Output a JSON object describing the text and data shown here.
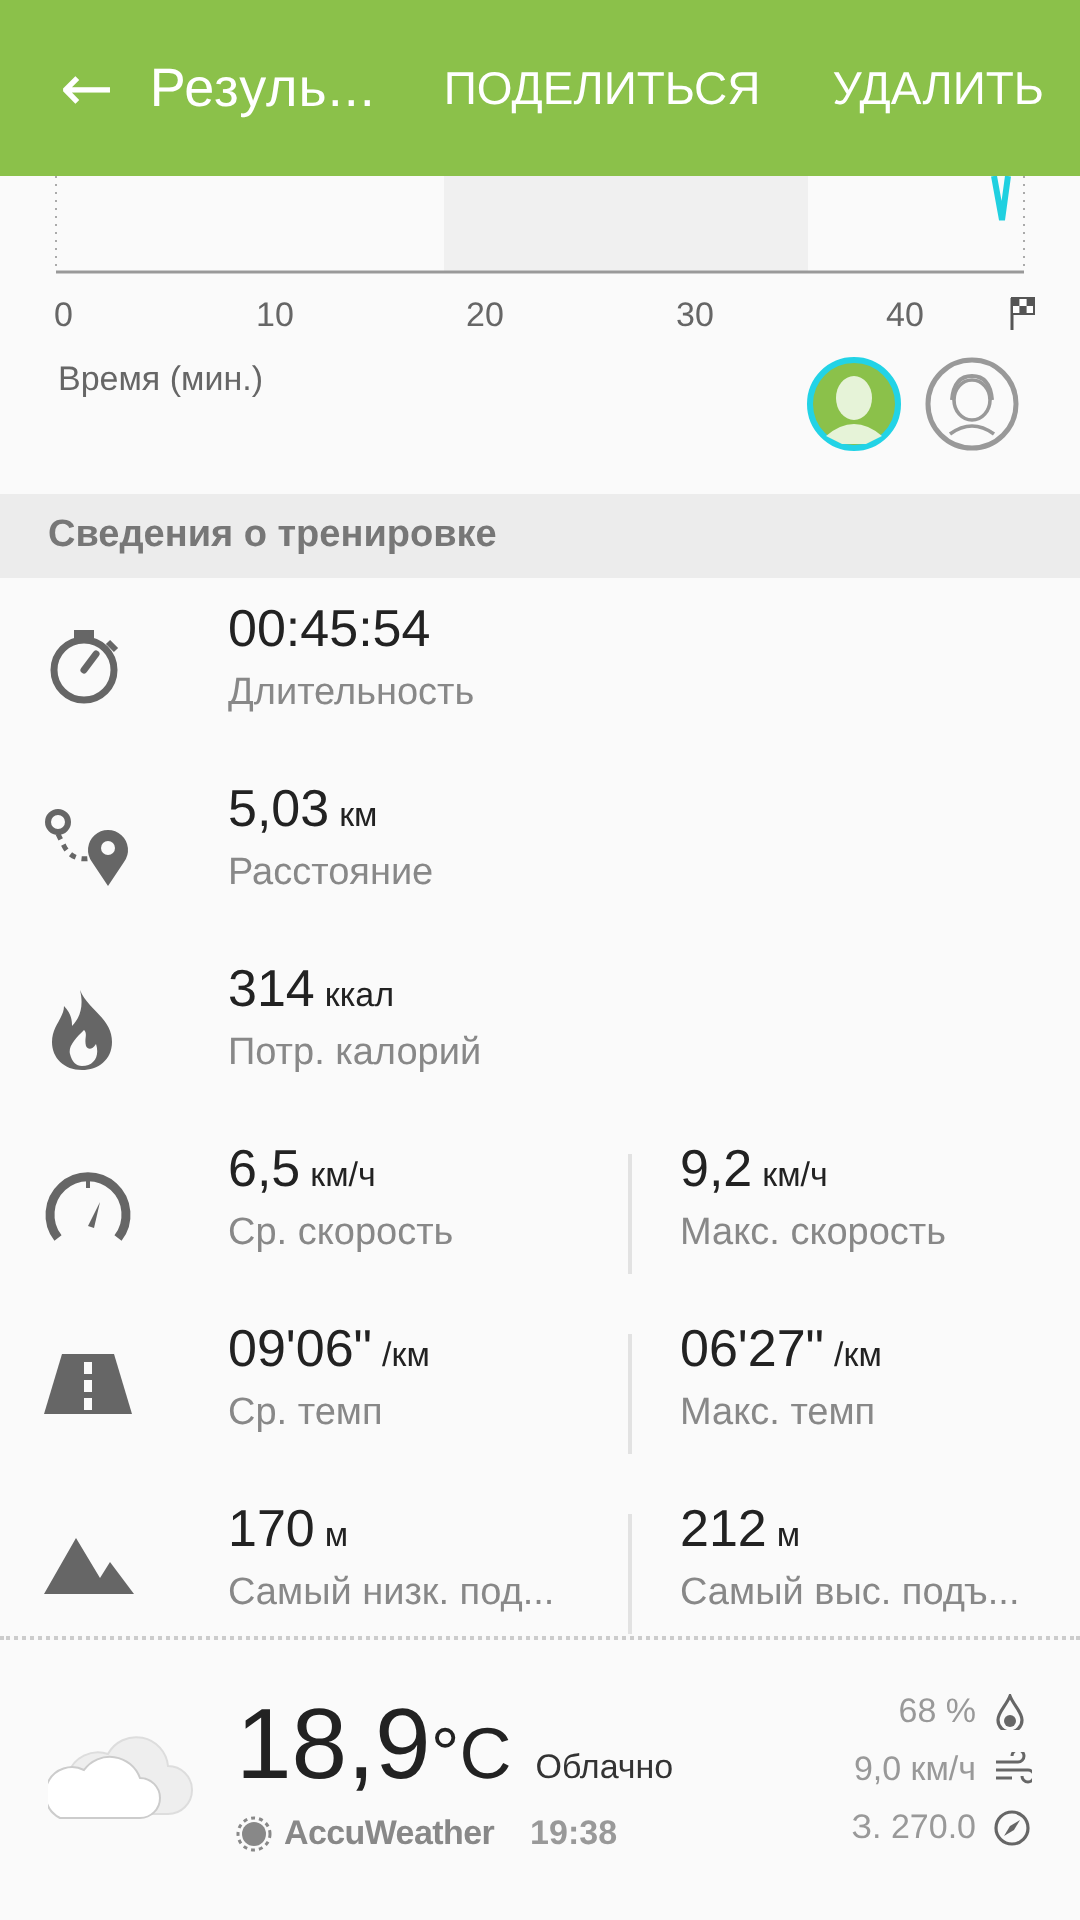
{
  "header": {
    "back": "←",
    "title": "Резуль...",
    "actions": [
      "ПОДЕЛИТЬСЯ",
      "УДАЛИТЬ"
    ]
  },
  "chart": {
    "x_ticks": [
      "0",
      "10",
      "20",
      "30",
      "40"
    ],
    "x_label": "Время (мин.)"
  },
  "avatars": [
    {
      "selected": true
    },
    {
      "selected": false
    }
  ],
  "section_title": "Сведения о тренировке",
  "stats": [
    {
      "kind": "duration",
      "items": [
        {
          "value": "00:45:54",
          "label": "Длительность"
        }
      ]
    },
    {
      "kind": "distance",
      "items": [
        {
          "value": "5,03",
          "unit": "км",
          "label": "Расстояние"
        }
      ]
    },
    {
      "kind": "calories",
      "items": [
        {
          "value": "314",
          "unit": "ккал",
          "label": "Потр. калорий"
        }
      ]
    },
    {
      "kind": "speed",
      "items": [
        {
          "value": "6,5",
          "unit": "км/ч",
          "label": "Ср. скорость"
        },
        {
          "value": "9,2",
          "unit": "км/ч",
          "label": "Макс. скорость"
        }
      ]
    },
    {
      "kind": "pace",
      "items": [
        {
          "value": "09'06\"",
          "unit": "/км",
          "label": "Ср. темп"
        },
        {
          "value": "06'27\"",
          "unit": "/км",
          "label": "Макс. темп"
        }
      ]
    },
    {
      "kind": "elevation",
      "items": [
        {
          "value": "170",
          "unit": "м",
          "label": "Самый низк. под..."
        },
        {
          "value": "212",
          "unit": "м",
          "label": "Самый выс. подъ..."
        }
      ]
    }
  ],
  "weather": {
    "temperature": "18,9",
    "temperature_unit": "°C",
    "condition": "Облачно",
    "provider": "AccuWeather",
    "time": "19:38",
    "details": [
      {
        "kind": "humidity",
        "text": "68 %"
      },
      {
        "kind": "wind",
        "text": "9,0 км/ч"
      },
      {
        "kind": "direction",
        "text": "З. 270.0"
      }
    ]
  }
}
